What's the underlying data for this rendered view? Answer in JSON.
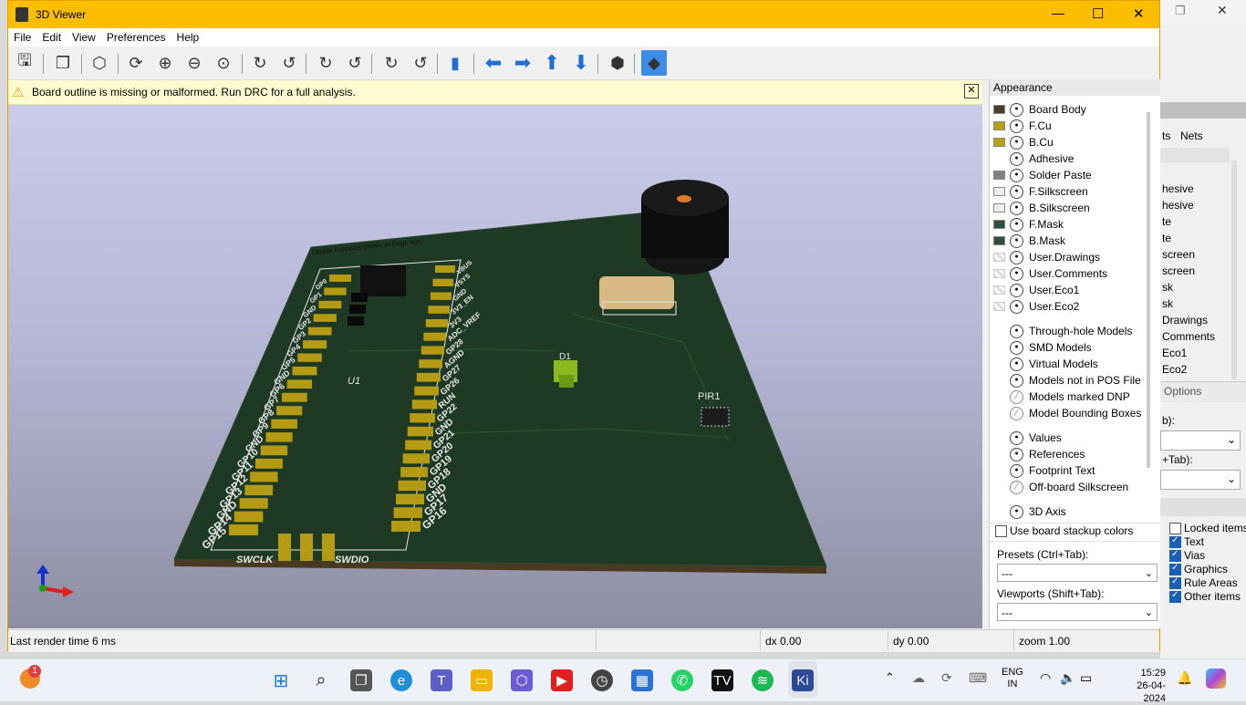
{
  "window": {
    "title": "3D Viewer",
    "controls": {
      "minimize": "—",
      "maximize": "☐",
      "close": "✕"
    }
  },
  "menu": [
    "File",
    "Edit",
    "View",
    "Preferences",
    "Help"
  ],
  "warning": {
    "text": "Board outline is missing or malformed. Run DRC for a full analysis."
  },
  "pcb": {
    "ref_u1": "U1",
    "ref_d1": "D1",
    "ref_pir": "PIR1",
    "note": "Copper Keepouts shown on Dwgs layer",
    "left_pins": [
      "GP0",
      "GP1",
      "GND",
      "GP2",
      "GP3",
      "GP4",
      "GP5",
      "GND",
      "GP6",
      "GP7",
      "GP8",
      "GP9",
      "GND",
      "GP10",
      "GP11",
      "GP12",
      "GP13",
      "GND",
      "GP14",
      "GP15"
    ],
    "right_pins": [
      "VBUS",
      "VSYS",
      "GND",
      "3V3_EN",
      "3V3",
      "ADC_VREF",
      "GP28",
      "AGND",
      "GP27",
      "GP26",
      "RUN",
      "GP22",
      "GND",
      "GP21",
      "GP20",
      "GP19",
      "GP18",
      "GND",
      "GP17",
      "GP16"
    ],
    "swclk": "SWCLK",
    "swdio": "SWDIO"
  },
  "appearance": {
    "header": "Appearance",
    "layers": [
      {
        "name": "Board Body",
        "color": "#4a3f2a",
        "swatch": "solid"
      },
      {
        "name": "F.Cu",
        "color": "#b3a21a",
        "swatch": "solid"
      },
      {
        "name": "B.Cu",
        "color": "#b3a21a",
        "swatch": "solid"
      },
      {
        "name": "Adhesive",
        "color": "",
        "swatch": "none"
      },
      {
        "name": "Solder Paste",
        "color": "#808080",
        "swatch": "solid"
      },
      {
        "name": "F.Silkscreen",
        "color": "#eeeeee",
        "swatch": "solid"
      },
      {
        "name": "B.Silkscreen",
        "color": "#eeeeee",
        "swatch": "solid"
      },
      {
        "name": "F.Mask",
        "color": "#2f4f3a",
        "swatch": "solid"
      },
      {
        "name": "B.Mask",
        "color": "#2f4f3a",
        "swatch": "solid"
      },
      {
        "name": "User.Drawings",
        "color": "",
        "swatch": "checker"
      },
      {
        "name": "User.Comments",
        "color": "",
        "swatch": "checker"
      },
      {
        "name": "User.Eco1",
        "color": "",
        "swatch": "checker"
      },
      {
        "name": "User.Eco2",
        "color": "",
        "swatch": "checker"
      }
    ],
    "models": [
      {
        "name": "Through-hole Models",
        "visible": true
      },
      {
        "name": "SMD Models",
        "visible": true
      },
      {
        "name": "Virtual Models",
        "visible": true
      },
      {
        "name": "Models not in POS File",
        "visible": true
      },
      {
        "name": "Models marked DNP",
        "visible": false
      },
      {
        "name": "Model Bounding Boxes",
        "visible": false
      }
    ],
    "texts": [
      {
        "name": "Values",
        "visible": true
      },
      {
        "name": "References",
        "visible": true
      },
      {
        "name": "Footprint Text",
        "visible": true
      },
      {
        "name": "Off-board Silkscreen",
        "visible": false
      }
    ],
    "axis": "3D Axis",
    "stackup_checkbox": "Use board stackup colors",
    "presets_label": "Presets (Ctrl+Tab):",
    "presets_value": "---",
    "viewports_label": "Viewports (Shift+Tab):",
    "viewports_value": "---"
  },
  "statusbar": {
    "render": "Last render time 6 ms",
    "dx": "dx 0.00",
    "dy": "dy 0.00",
    "zoom": "zoom 1.00"
  },
  "background_window": {
    "tab_fragment": "ts",
    "nets_tab": "Nets",
    "layer_fragments": [
      "hesive",
      "hesive",
      "te",
      "te",
      "screen",
      "screen",
      "sk",
      "sk",
      "Drawings",
      "Comments",
      "Eco1",
      "Eco2"
    ],
    "options": "Options",
    "label1": "b):",
    "label2": "+Tab):",
    "checks": [
      {
        "label": "Locked items",
        "checked": false
      },
      {
        "label": "Text",
        "checked": true
      },
      {
        "label": "Vias",
        "checked": true
      },
      {
        "label": "Graphics",
        "checked": true
      },
      {
        "label": "Rule Areas",
        "checked": true
      },
      {
        "label": "Other items",
        "checked": true
      }
    ]
  },
  "taskbar": {
    "lang": "ENG",
    "region": "IN",
    "time": "15:29",
    "date": "26-04-2024",
    "badge": "1"
  }
}
